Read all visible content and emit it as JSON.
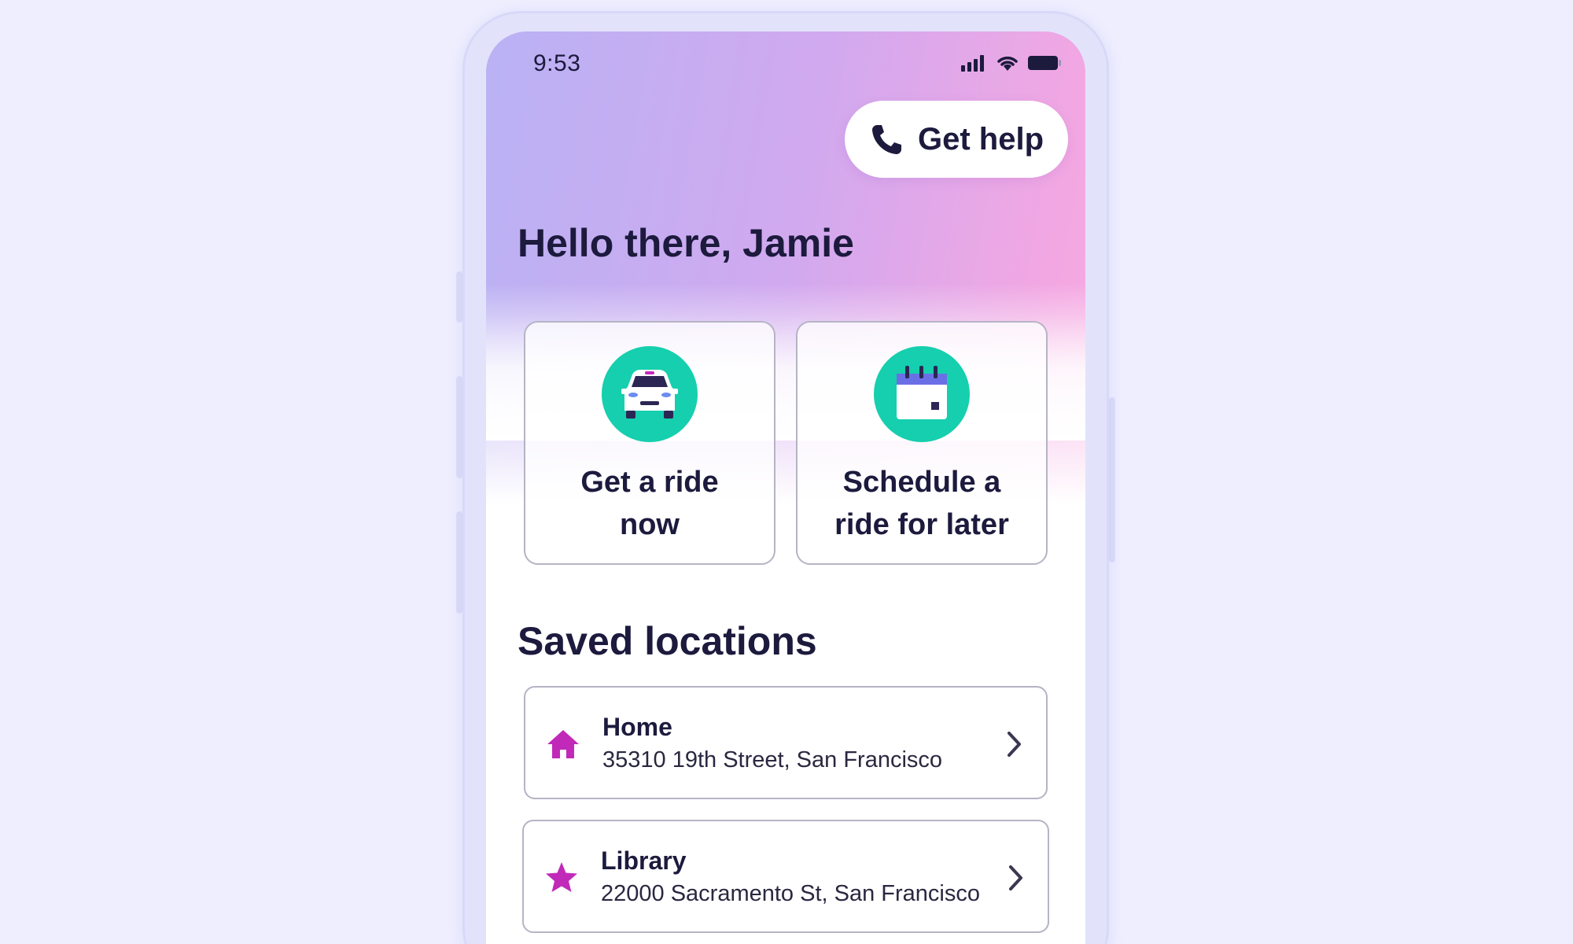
{
  "status_bar": {
    "time": "9:53"
  },
  "help_button": {
    "label": "Get help"
  },
  "greeting": "Hello there, Jamie",
  "actions": [
    {
      "label": "Get a ride now",
      "icon": "car-icon"
    },
    {
      "label": "Schedule a ride for later",
      "icon": "calendar-icon"
    }
  ],
  "saved_locations": {
    "title": "Saved locations",
    "items": [
      {
        "name": "Home",
        "address": "35310 19th Street, San Francisco",
        "icon": "home-icon"
      },
      {
        "name": "Library",
        "address": "22000 Sacramento St, San Francisco",
        "icon": "star-icon"
      }
    ]
  },
  "colors": {
    "accent_teal": "#16cfae",
    "accent_magenta": "#c12ab9",
    "text_dark": "#1c1a3d",
    "background": "#eeeeff"
  }
}
